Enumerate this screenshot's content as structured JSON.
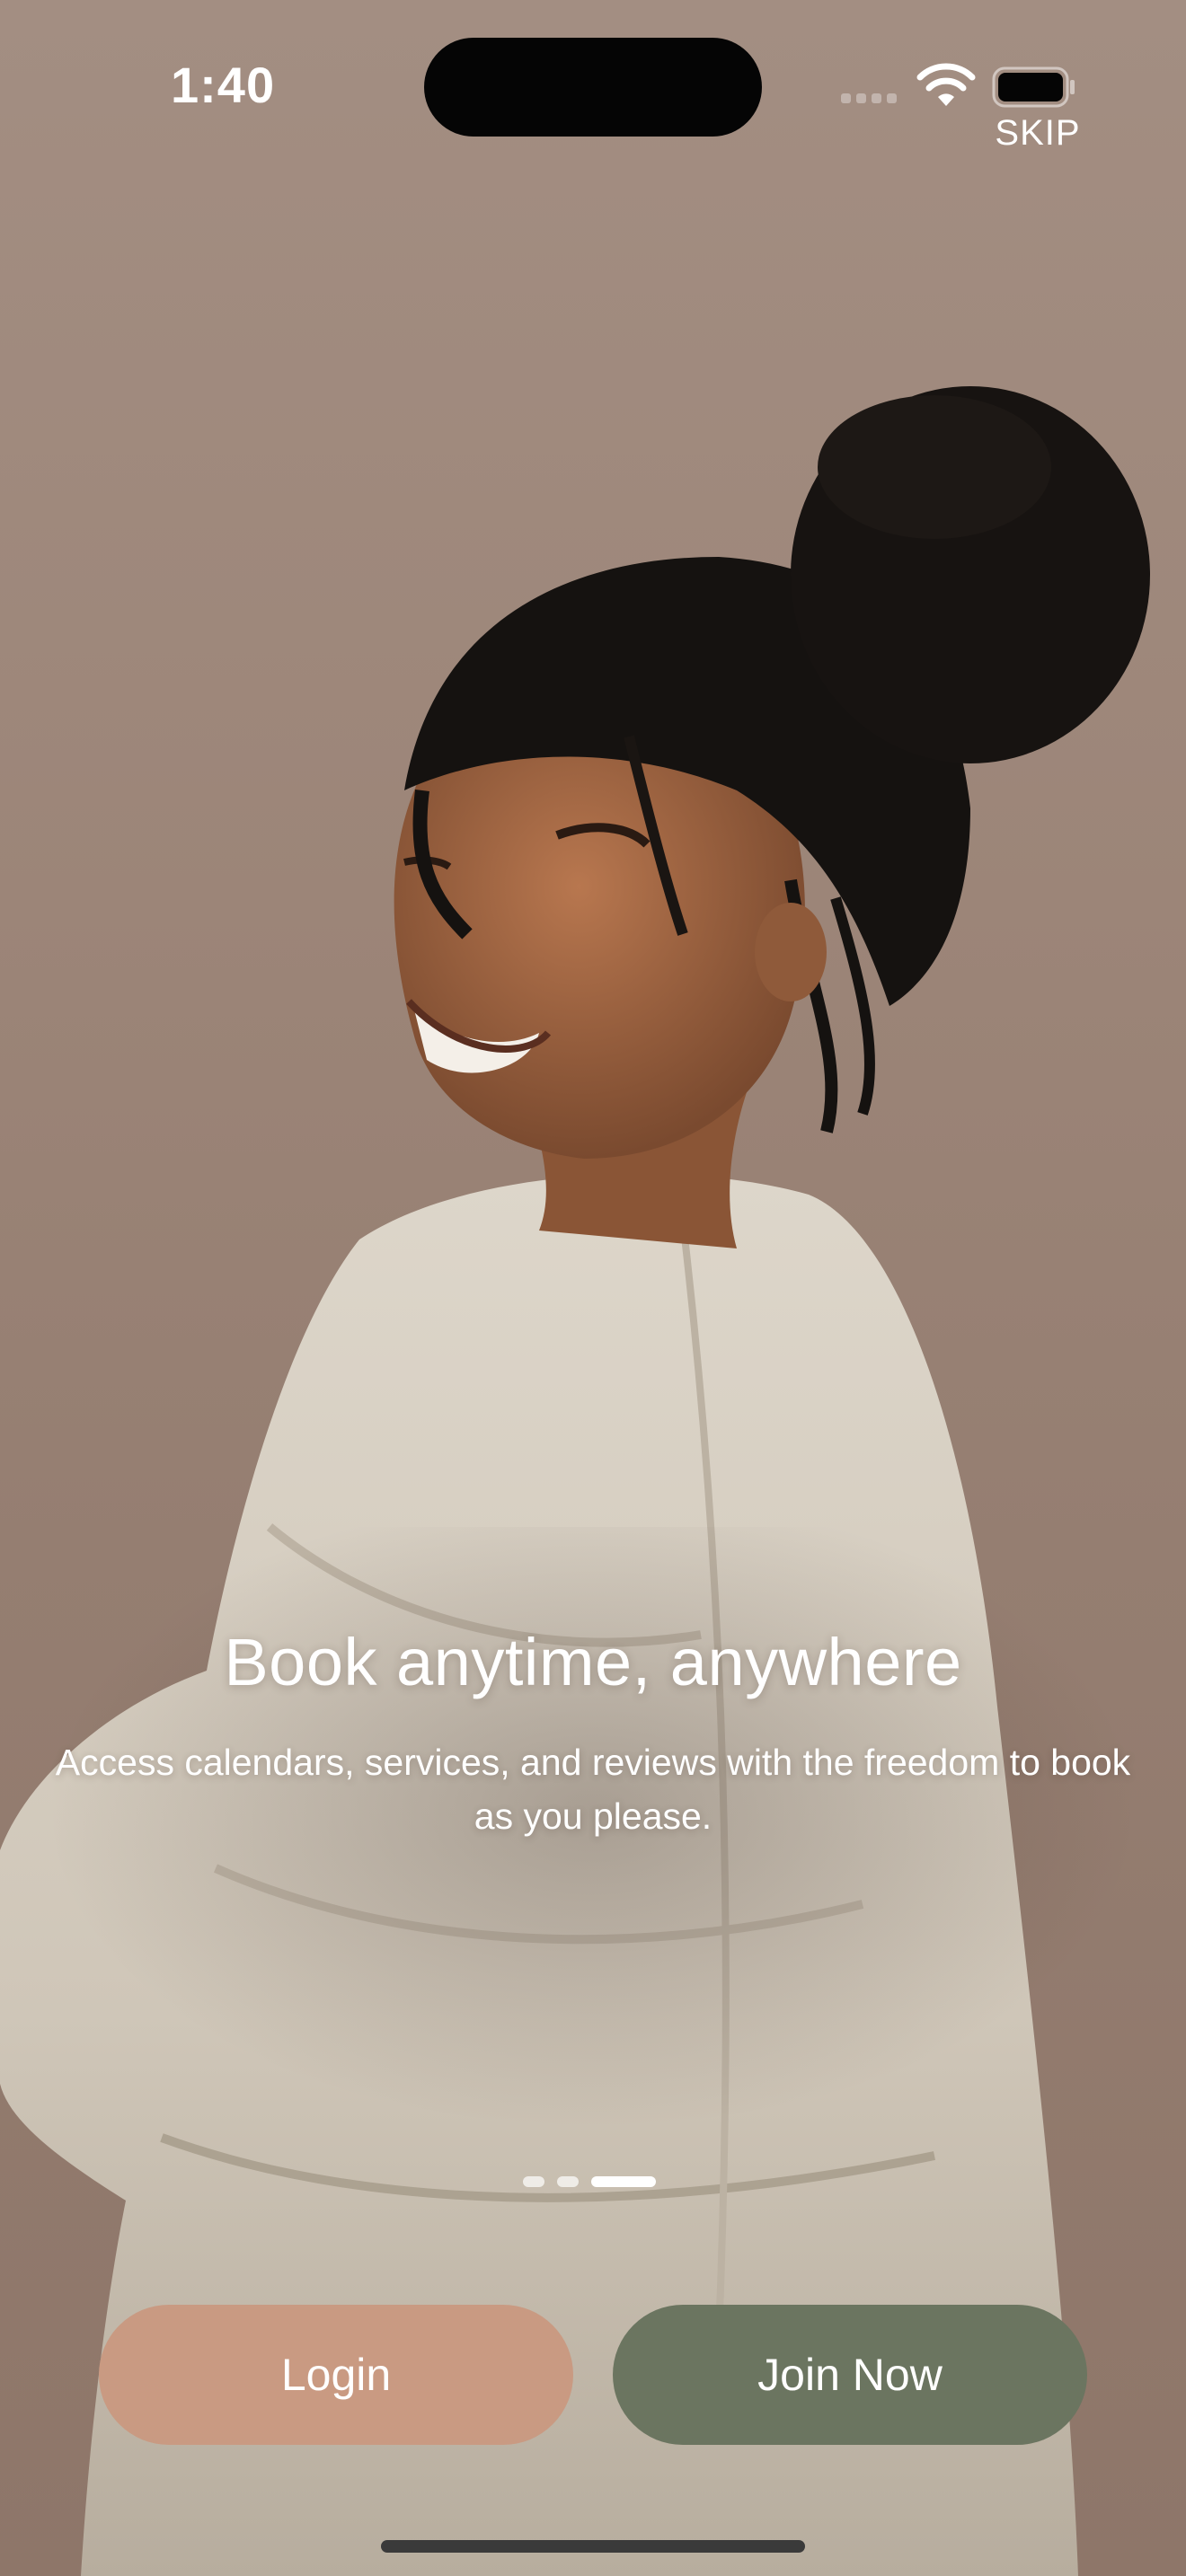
{
  "status_bar": {
    "time": "1:40"
  },
  "header": {
    "skip_label": "SKIP"
  },
  "onboarding": {
    "title": "Book anytime, anywhere",
    "subtitle": "Access calendars, services, and reviews with the freedom to book as you please.",
    "pager": {
      "total_pages": 3,
      "current_page": 3
    }
  },
  "actions": {
    "login_label": "Login",
    "join_label": "Join Now"
  },
  "colors": {
    "background": "#9c8578",
    "login_button": "#c99a82",
    "join_button": "#6b7560",
    "text": "#ffffff"
  },
  "icons": [
    "wifi-icon",
    "battery-icon",
    "signal-icon"
  ]
}
